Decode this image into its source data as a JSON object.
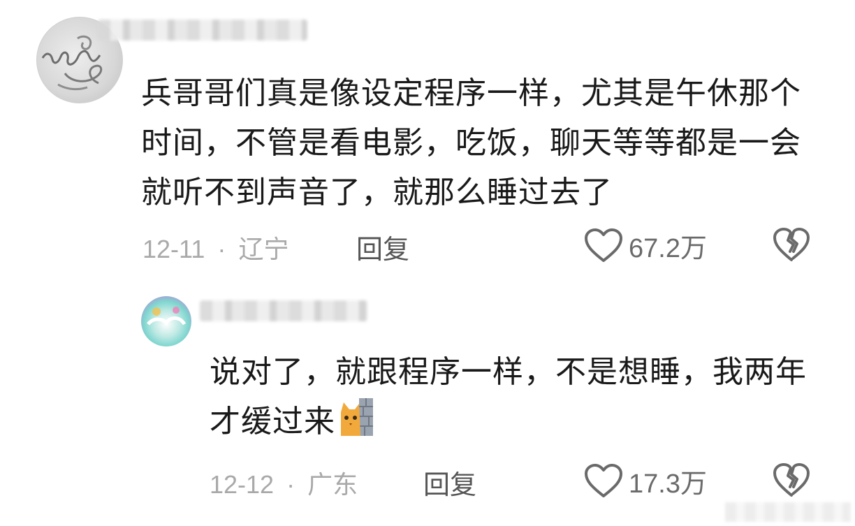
{
  "comments": [
    {
      "username": "",
      "text": "兵哥哥们真是像设定程序一样，尤其是午休那个时间，不管是看电影，吃饭，聊天等等都是一会就听不到声音了，就那么睡过去了",
      "date": "12-11",
      "separator": "·",
      "location": "辽宁",
      "reply_label": "回复",
      "likes": "67.2万",
      "avatar_icon": "handwritten-avatar",
      "like_icon": "heart-outline-icon",
      "dislike_icon": "broken-heart-icon"
    },
    {
      "username": "",
      "text": "说对了，就跟程序一样，不是想睡，我两年才缓过来",
      "emoji": "cat-peeking-wall-emoji",
      "date": "12-12",
      "separator": "·",
      "location": "广东",
      "reply_label": "回复",
      "likes": "17.3万",
      "avatar_icon": "colorful-avatar",
      "like_icon": "heart-outline-icon",
      "dislike_icon": "broken-heart-icon"
    }
  ],
  "colors": {
    "text": "#191919",
    "meta": "#a9a9a9",
    "reply": "#555555",
    "icon": "#6a6a6a"
  }
}
